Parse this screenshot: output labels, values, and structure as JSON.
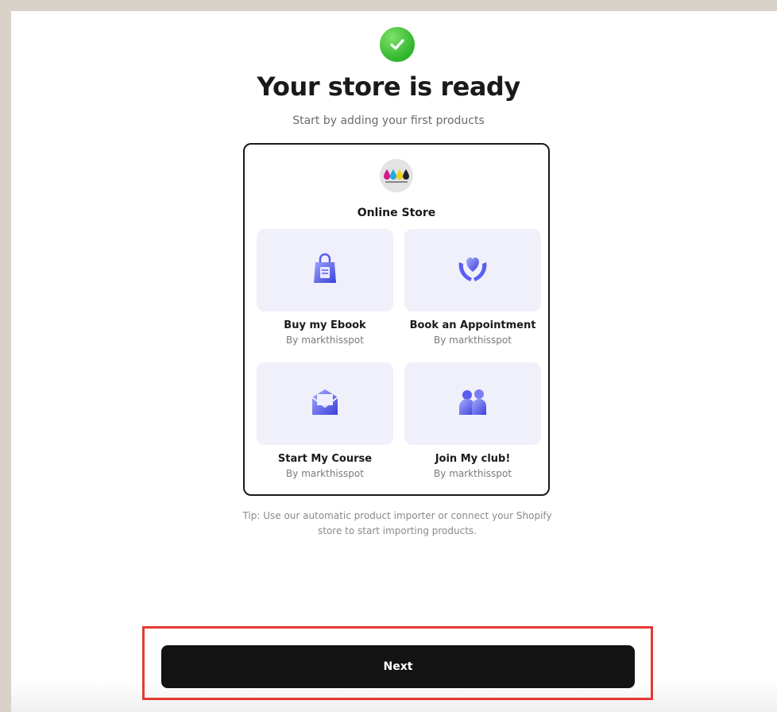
{
  "header": {
    "title": "Your store is ready",
    "subtitle": "Start by adding your first products"
  },
  "store": {
    "name": "Online Store",
    "logo_icon": "ink-drops-logo",
    "products": [
      {
        "name": "Buy my Ebook",
        "by": "By markthisspot",
        "icon": "ebook-bag-icon"
      },
      {
        "name": "Book an Appointment",
        "by": "By markthisspot",
        "icon": "heart-hands-icon"
      },
      {
        "name": "Start My Course",
        "by": "By markthisspot",
        "icon": "envelope-icon"
      },
      {
        "name": "Join My club!",
        "by": "By markthisspot",
        "icon": "people-icon"
      }
    ]
  },
  "tip": {
    "line1": "Tip: Use our automatic product importer or connect your Shopify",
    "line2": "store to start importing products."
  },
  "footer": {
    "next_label": "Next"
  },
  "colors": {
    "success": "#2fb52b",
    "accent_icon": "#5a5ef0",
    "tile_bg": "#f0f0fb",
    "button_bg": "#131313",
    "highlight": "#e53935"
  }
}
